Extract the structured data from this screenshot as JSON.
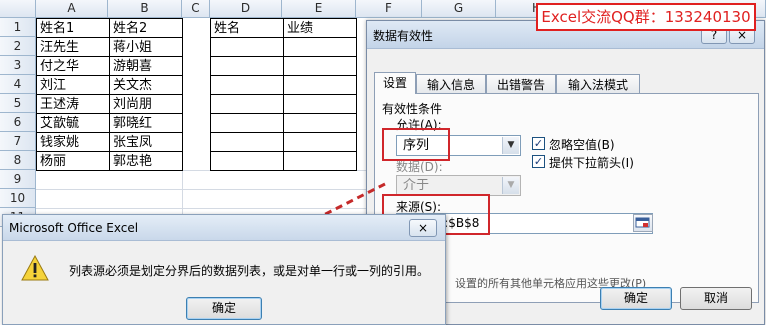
{
  "sheet": {
    "columns": [
      "A",
      "B",
      "C",
      "D",
      "E",
      "F",
      "G",
      "H"
    ],
    "rows": [
      "1",
      "2",
      "3",
      "4",
      "5",
      "6",
      "7",
      "8",
      "9",
      "10",
      "11"
    ],
    "colA": [
      "姓名1",
      "汪先生",
      "付之华",
      "刘江",
      "王述涛",
      "艾歆毓",
      "钱家姚",
      "杨丽"
    ],
    "colB": [
      "姓名2",
      "蒋小姐",
      "游朝喜",
      "关文杰",
      "刘尚朋",
      "郭晓红",
      "张宝凤",
      "郭忠艳"
    ],
    "colD_header": "姓名",
    "colE_header": "业绩"
  },
  "banner": {
    "text": "Excel交流QQ群：133240130"
  },
  "dialog": {
    "title": "数据有效性",
    "help": "?",
    "close": "×",
    "tabs": [
      "设置",
      "输入信息",
      "出错警告",
      "输入法模式"
    ],
    "section": "有效性条件",
    "allow_label": "允许(A):",
    "allow_value": "序列",
    "ignore_blank": "忽略空值(B)",
    "dropdown_arrow": "提供下拉箭头(I)",
    "data_label": "数据(D):",
    "data_value": "介于",
    "source_label": "来源(S):",
    "source_value": "=$A$2:$B$8",
    "apply_all": "设置的所有其他单元格应用这些更改(P)",
    "ok": "确定",
    "cancel": "取消"
  },
  "msgbox": {
    "title": "Microsoft Office Excel",
    "close": "×",
    "message": "列表源必须是划定分界后的数据列表，或是对单一行或一列的引用。",
    "ok": "确定"
  },
  "colors": {
    "accent_red": "#d0262b",
    "grid": "#d4dae3"
  }
}
